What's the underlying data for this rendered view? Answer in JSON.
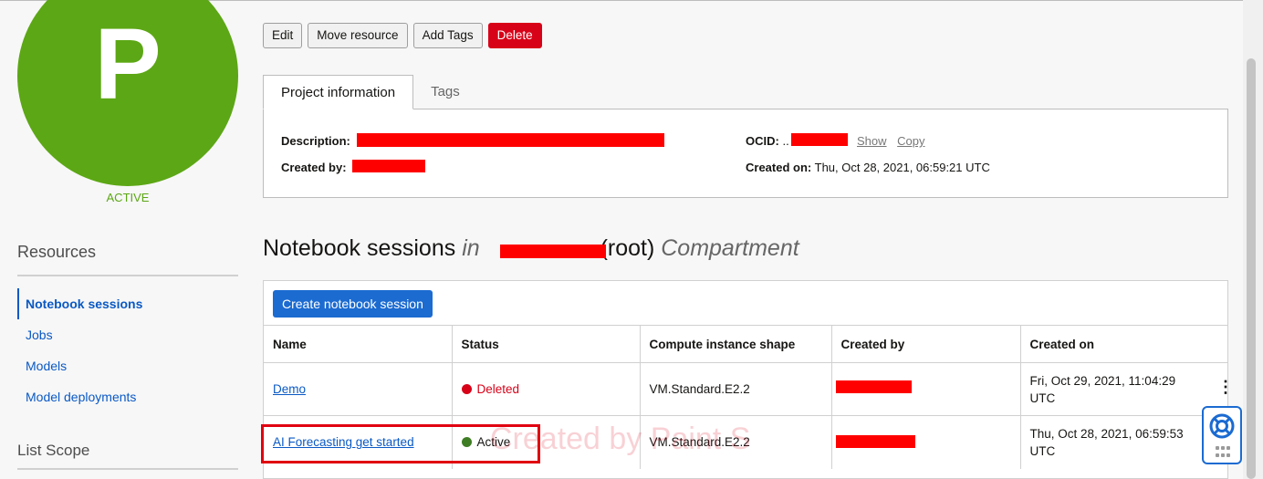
{
  "project": {
    "initial": "P",
    "state": "ACTIVE"
  },
  "resources": {
    "heading": "Resources",
    "items": [
      {
        "label": "Notebook sessions"
      },
      {
        "label": "Jobs"
      },
      {
        "label": "Models"
      },
      {
        "label": "Model deployments"
      }
    ],
    "scope_heading": "List Scope"
  },
  "toolbar": {
    "edit": "Edit",
    "move": "Move resource",
    "tags": "Add Tags",
    "delete": "Delete"
  },
  "tabs": {
    "info": "Project information",
    "tags": "Tags"
  },
  "info": {
    "description_label": "Description:",
    "created_by_label": "Created by:",
    "ocid_label": "OCID:",
    "ocid_prefix": "..",
    "show": "Show",
    "copy": "Copy",
    "created_on_label": "Created on:",
    "created_on_value": "Thu, Oct 28, 2021, 06:59:21 UTC"
  },
  "section": {
    "title_main": "Notebook sessions",
    "title_in": "in",
    "title_root": "(root)",
    "title_compartment": "Compartment"
  },
  "table": {
    "create_button": "Create notebook session",
    "columns": [
      "Name",
      "Status",
      "Compute instance shape",
      "Created by",
      "Created on"
    ],
    "rows": [
      {
        "name": "Demo",
        "status": "Deleted",
        "shape": "VM.Standard.E2.2",
        "created_on": "Fri, Oct 29, 2021, 11:04:29 UTC"
      },
      {
        "name": "AI Forecasting get started",
        "status": "Active",
        "shape": "VM.Standard.E2.2",
        "created_on": "Thu, Oct 28, 2021, 06:59:53 UTC"
      }
    ]
  },
  "watermark": "Created by Paint S",
  "colors": {
    "brand_green": "#5ca715",
    "accent_blue": "#1b6bd1",
    "danger_red": "#d80218"
  },
  "icons": {
    "help": "life-ring-icon",
    "apps": "grid-icon",
    "row_actions": "kebab-icon"
  }
}
